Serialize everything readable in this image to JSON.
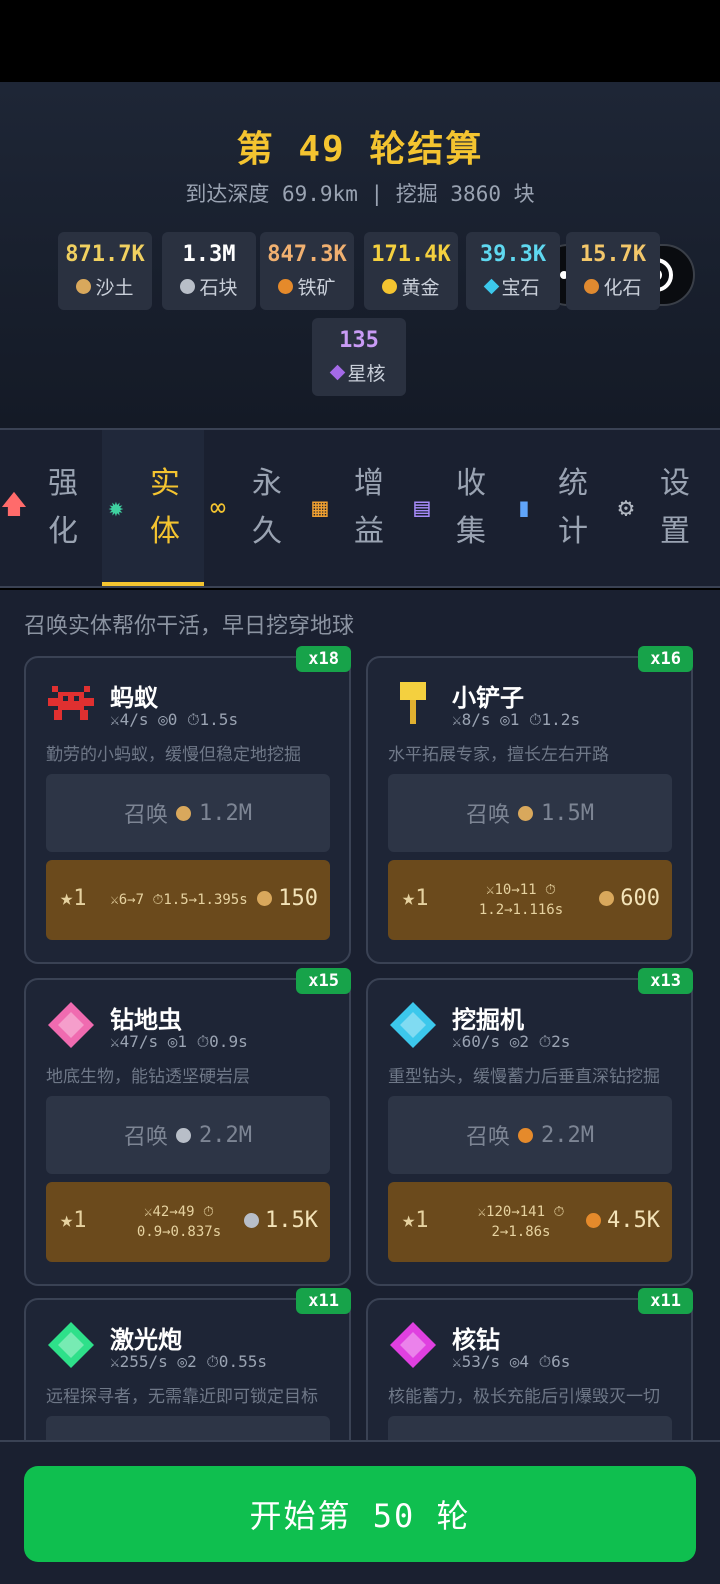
{
  "summary": {
    "title": "第 49 轮结算",
    "sub": "到达深度 69.9km | 挖掘 3860 块",
    "resources": [
      {
        "value": "871.7K",
        "label": "沙土",
        "color": "#f0d060",
        "icon_color": "#d9a85c",
        "icon": "sand-icon"
      },
      {
        "value": "1.3M",
        "label": "石块",
        "color": "#ffffff",
        "icon_color": "#b8bec8",
        "icon": "stone-icon"
      },
      {
        "value": "847.3K",
        "label": "铁矿",
        "color": "#f0b070",
        "icon_color": "#e58a2b",
        "icon": "iron-ore-icon"
      },
      {
        "value": "171.4K",
        "label": "黄金",
        "color": "#f4d03f",
        "icon_color": "#f4c430",
        "icon": "gold-icon"
      },
      {
        "value": "39.3K",
        "label": "宝石",
        "color": "#5fd8f0",
        "icon_color": "#3cc8ec",
        "icon": "gem-icon"
      },
      {
        "value": "15.7K",
        "label": "化石",
        "color": "#f3c76a",
        "icon_color": "#e08a30",
        "icon": "fossil-icon"
      },
      {
        "value": "135",
        "label": "星核",
        "color": "#c99bf5",
        "icon_color": "#a46ae8",
        "icon": "star-core-icon"
      }
    ]
  },
  "tabs": [
    {
      "label": "强化",
      "icon": "upgrade-arrow-icon",
      "glyph": "🡅",
      "color": "#ff6b6b"
    },
    {
      "label": "实体",
      "icon": "gear-entity-icon",
      "glyph": "✹",
      "color": "#3fd1a0",
      "active": true
    },
    {
      "label": "永久",
      "icon": "infinity-icon",
      "glyph": "∞",
      "color": "#f4c430"
    },
    {
      "label": "增益",
      "icon": "chest-icon",
      "glyph": "▦",
      "color": "#f0a030"
    },
    {
      "label": "收集",
      "icon": "book-icon",
      "glyph": "▤",
      "color": "#a78bfa"
    },
    {
      "label": "统计",
      "icon": "bar-chart-icon",
      "glyph": "▮",
      "color": "#60a5fa"
    },
    {
      "label": "设置",
      "icon": "settings-gear-icon",
      "glyph": "⚙",
      "color": "#b0b6c0"
    }
  ],
  "hint": "召唤实体帮你干活，早日挖穿地球",
  "cards": [
    {
      "name": "蚂蚁",
      "count": "x18",
      "stats": "⚔4/s  ◎0  ⏱1.5s",
      "desc": "勤劳的小蚂蚁，缓慢但稳定地挖掘",
      "summon_label": "召唤",
      "summon_cost": "1.2M",
      "res_color": "#d9a85c",
      "up_level": "★1",
      "up_line1": "⚔6→7 ⏱1.5→1.395s",
      "up_line2": "",
      "up_cost": "150",
      "up_res_color": "#d9a85c",
      "icon": "ant-icon",
      "icon_color": "#e03030"
    },
    {
      "name": "小铲子",
      "count": "x16",
      "stats": "⚔8/s  ◎1  ⏱1.2s",
      "desc": "水平拓展专家，擅长左右开路",
      "summon_label": "召唤",
      "summon_cost": "1.5M",
      "res_color": "#d9a85c",
      "up_level": "★1",
      "up_line1": "⚔10→11 ⏱",
      "up_line2": "1.2→1.116s",
      "up_cost": "600",
      "up_res_color": "#d9a85c",
      "icon": "shovel-icon",
      "icon_color": "#f4d03f"
    },
    {
      "name": "钻地虫",
      "count": "x15",
      "stats": "⚔47/s  ◎1  ⏱0.9s",
      "desc": "地底生物，能钻透坚硬岩层",
      "summon_label": "召唤",
      "summon_cost": "2.2M",
      "res_color": "#b8bec8",
      "up_level": "★1",
      "up_line1": "⚔42→49 ⏱",
      "up_line2": "0.9→0.837s",
      "up_cost": "1.5K",
      "up_res_color": "#b8bec8",
      "icon": "worm-icon",
      "icon_color": "#f06bb0"
    },
    {
      "name": "挖掘机",
      "count": "x13",
      "stats": "⚔60/s  ◎2  ⏱2s",
      "desc": "重型钻头，缓慢蓄力后垂直深钻挖掘",
      "summon_label": "召唤",
      "summon_cost": "2.2M",
      "res_color": "#e58a2b",
      "up_level": "★1",
      "up_line1": "⚔120→141 ⏱",
      "up_line2": "2→1.86s",
      "up_cost": "4.5K",
      "up_res_color": "#e58a2b",
      "icon": "excavator-icon",
      "icon_color": "#3cc8ec"
    },
    {
      "name": "激光炮",
      "count": "x11",
      "stats": "⚔255/s  ◎2  ⏱0.55s",
      "desc": "远程探寻者，无需靠近即可锁定目标",
      "summon_label": "",
      "summon_cost": "",
      "res_color": "#b8bec8",
      "up_level": "",
      "up_line1": "",
      "up_line2": "",
      "up_cost": "",
      "up_res_color": "#b8bec8",
      "icon": "laser-cannon-icon",
      "icon_color": "#2ee08a"
    },
    {
      "name": "核钻",
      "count": "x11",
      "stats": "⚔53/s  ◎4  ⏱6s",
      "desc": "核能蓄力，极长充能后引爆毁灭一切",
      "summon_label": "",
      "summon_cost": "",
      "res_color": "#b8bec8",
      "up_level": "",
      "up_line1": "",
      "up_line2": "",
      "up_cost": "",
      "up_res_color": "#b8bec8",
      "icon": "nuclear-drill-icon",
      "icon_color": "#e040e0"
    }
  ],
  "start_button": "开始第 50 轮"
}
